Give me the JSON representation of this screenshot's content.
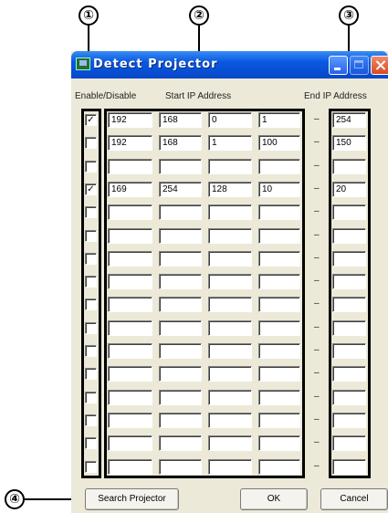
{
  "callouts": [
    "①",
    "②",
    "③",
    "④"
  ],
  "window": {
    "title": "Detect Projector"
  },
  "headers": {
    "enable": "Enable/Disable",
    "start": "Start IP Address",
    "end": "End IP Address"
  },
  "separator": "–",
  "rows": [
    {
      "checked": true,
      "start": [
        "192",
        "168",
        "0",
        "1"
      ],
      "end": "254"
    },
    {
      "checked": false,
      "start": [
        "192",
        "168",
        "1",
        "100"
      ],
      "end": "150"
    },
    {
      "checked": false,
      "start": [
        "",
        "",
        "",
        ""
      ],
      "end": ""
    },
    {
      "checked": true,
      "start": [
        "169",
        "254",
        "128",
        "10"
      ],
      "end": "20"
    },
    {
      "checked": false,
      "start": [
        "",
        "",
        "",
        ""
      ],
      "end": ""
    },
    {
      "checked": false,
      "start": [
        "",
        "",
        "",
        ""
      ],
      "end": ""
    },
    {
      "checked": false,
      "start": [
        "",
        "",
        "",
        ""
      ],
      "end": ""
    },
    {
      "checked": false,
      "start": [
        "",
        "",
        "",
        ""
      ],
      "end": ""
    },
    {
      "checked": false,
      "start": [
        "",
        "",
        "",
        ""
      ],
      "end": ""
    },
    {
      "checked": false,
      "start": [
        "",
        "",
        "",
        ""
      ],
      "end": ""
    },
    {
      "checked": false,
      "start": [
        "",
        "",
        "",
        ""
      ],
      "end": ""
    },
    {
      "checked": false,
      "start": [
        "",
        "",
        "",
        ""
      ],
      "end": ""
    },
    {
      "checked": false,
      "start": [
        "",
        "",
        "",
        ""
      ],
      "end": ""
    },
    {
      "checked": false,
      "start": [
        "",
        "",
        "",
        ""
      ],
      "end": ""
    },
    {
      "checked": false,
      "start": [
        "",
        "",
        "",
        ""
      ],
      "end": ""
    },
    {
      "checked": false,
      "start": [
        "",
        "",
        "",
        ""
      ],
      "end": ""
    }
  ],
  "checkmark": "✓",
  "buttons": {
    "search": "Search Projector",
    "ok": "OK",
    "cancel": "Cancel"
  },
  "icons": {
    "app": "projector-app-icon",
    "minimize": "minimize-icon",
    "maximize": "maximize-icon",
    "close": "close-icon"
  }
}
